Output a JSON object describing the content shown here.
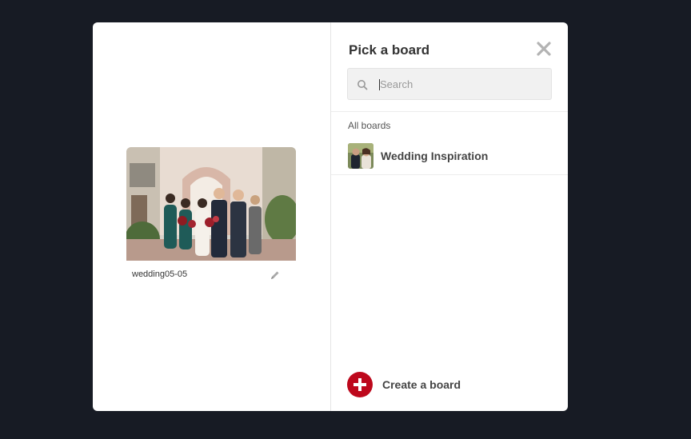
{
  "pin": {
    "image_alt": "Wedding party group photo",
    "caption": "wedding05-05"
  },
  "picker": {
    "title": "Pick a board",
    "search_placeholder": "Search",
    "search_value": "",
    "section_label": "All boards",
    "boards": [
      {
        "name": "Wedding Inspiration"
      }
    ],
    "create_label": "Create a board"
  },
  "colors": {
    "accent": "#bd081c",
    "backdrop": "#171b24"
  },
  "icons": {
    "close": "close-icon",
    "search": "search-icon",
    "edit": "pencil-icon",
    "create": "plus-icon"
  }
}
